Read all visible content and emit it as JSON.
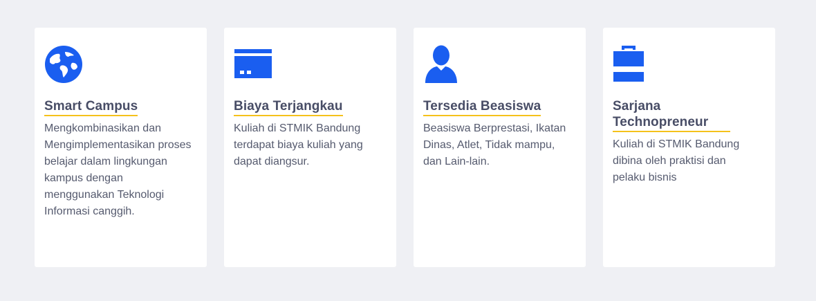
{
  "colors": {
    "background": "#eff0f4",
    "card": "#ffffff",
    "icon": "#1a5ef0",
    "title": "#484d66",
    "underline": "#f5c21b",
    "text": "#555a6e"
  },
  "features": [
    {
      "icon": "globe-icon",
      "title": "Smart Campus",
      "description": "Mengkombinasikan dan Mengimplementasikan proses belajar dalam lingkungan kampus dengan menggunakan Teknologi Informasi canggih."
    },
    {
      "icon": "credit-card-icon",
      "title": "Biaya Terjangkau",
      "description": "Kuliah di STMIK Bandung terdapat biaya kuliah yang dapat diangsur."
    },
    {
      "icon": "user-icon",
      "title": "Tersedia Beasiswa",
      "description": "Beasiswa Berprestasi, Ikatan Dinas, Atlet, Tidak mampu, dan Lain-lain."
    },
    {
      "icon": "briefcase-icon",
      "title": "Sarjana Technopreneur",
      "description": "Kuliah di STMIK Bandung dibina oleh praktisi dan pelaku bisnis"
    }
  ]
}
